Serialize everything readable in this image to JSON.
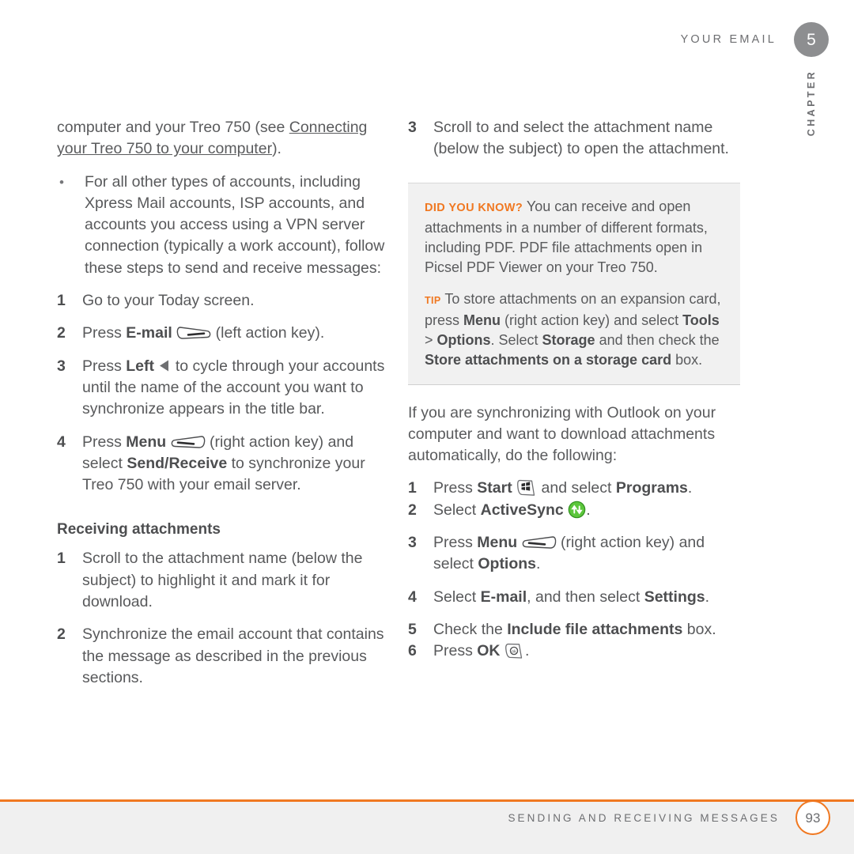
{
  "header": {
    "title": "YOUR EMAIL",
    "chapter_number": "5",
    "chapter_label": "CHAPTER"
  },
  "footer": {
    "title": "SENDING AND RECEIVING MESSAGES",
    "page_number": "93",
    "rule_color": "#f07821"
  },
  "colors": {
    "accent_orange": "#f07821",
    "body_text": "#5a5b5d",
    "bold_text": "#4d4e50",
    "tipbox_background": "#f1f1f1",
    "chapter_circle": "#8d8e90",
    "activesync_green": "#5cc63c"
  },
  "left_column": {
    "continued_paragraph": {
      "text_before": "computer and your Treo 750 (see ",
      "link_text": "Connecting your Treo 750 to your computer",
      "text_after": ")."
    },
    "bullet": {
      "marker": "•",
      "text": "For all other types of accounts, including Xpress Mail accounts, ISP accounts, and accounts you access using a VPN server connection (typically a work account), follow these steps to send and receive messages:"
    },
    "steps": [
      {
        "marker": "1",
        "segments": [
          {
            "text": "Go to your Today screen.",
            "style": "normal"
          }
        ]
      },
      {
        "marker": "2",
        "segments": [
          {
            "text": "Press ",
            "style": "normal"
          },
          {
            "text": "E-mail",
            "style": "bold"
          },
          {
            "text": " ",
            "style": "normal"
          },
          {
            "icon": "left-action-key-icon"
          },
          {
            "text": " (left action key).",
            "style": "normal"
          }
        ]
      },
      {
        "marker": "3",
        "segments": [
          {
            "text": "Press ",
            "style": "normal"
          },
          {
            "text": "Left",
            "style": "bold"
          },
          {
            "text": " ",
            "style": "normal"
          },
          {
            "icon": "left-arrow-icon"
          },
          {
            "text": " to cycle through your accounts until the name of the account you want to synchronize appears in the title bar.",
            "style": "normal"
          }
        ]
      },
      {
        "marker": "4",
        "segments": [
          {
            "text": "Press ",
            "style": "normal"
          },
          {
            "text": "Menu",
            "style": "bold"
          },
          {
            "text": " ",
            "style": "normal"
          },
          {
            "icon": "right-action-key-icon"
          },
          {
            "text": " (right action key) and select ",
            "style": "normal"
          },
          {
            "text": "Send/Receive",
            "style": "bold"
          },
          {
            "text": " to synchronize your Treo 750 with your email server.",
            "style": "normal"
          }
        ]
      }
    ],
    "subheading": "Receiving attachments",
    "attachment_steps": [
      {
        "marker": "1",
        "text": "Scroll to the attachment name (below the subject) to highlight it and mark it for download."
      },
      {
        "marker": "2",
        "text": "Synchronize the email account that contains the message as described in the previous sections."
      }
    ]
  },
  "right_column": {
    "step_three": {
      "marker": "3",
      "text": "Scroll to and select the attachment name (below the subject) to open the attachment."
    },
    "tipbox": {
      "did_you_know_label": "DID YOU KNOW?",
      "did_you_know_text": "You can receive and open attachments in a number of different formats, including PDF. PDF file attachments open in Picsel PDF Viewer on your Treo 750.",
      "tip_label": "TIP",
      "tip_segments": [
        {
          "text": "To store attachments on an expansion card, press ",
          "style": "normal"
        },
        {
          "text": "Menu",
          "style": "bold"
        },
        {
          "text": " (right action key) and select ",
          "style": "normal"
        },
        {
          "text": "Tools",
          "style": "bold"
        },
        {
          "text": " > ",
          "style": "normal"
        },
        {
          "text": "Options",
          "style": "bold"
        },
        {
          "text": ". Select ",
          "style": "normal"
        },
        {
          "text": "Storage",
          "style": "bold"
        },
        {
          "text": " and then check the ",
          "style": "normal"
        },
        {
          "text": "Store attachments on a storage card",
          "style": "bold"
        },
        {
          "text": " box.",
          "style": "normal"
        }
      ]
    },
    "intro_paragraph": "If you are synchronizing with Outlook on your computer and want to download attachments automatically, do the following:",
    "steps": [
      {
        "marker": "1",
        "segments": [
          {
            "text": "Press ",
            "style": "normal"
          },
          {
            "text": "Start",
            "style": "bold"
          },
          {
            "text": " ",
            "style": "normal"
          },
          {
            "icon": "start-windows-icon"
          },
          {
            "text": " and select ",
            "style": "normal"
          },
          {
            "text": "Programs",
            "style": "bold"
          },
          {
            "text": ".",
            "style": "normal"
          }
        ]
      },
      {
        "marker": "2",
        "segments": [
          {
            "text": "Select ",
            "style": "normal"
          },
          {
            "text": "ActiveSync",
            "style": "bold"
          },
          {
            "text": " ",
            "style": "normal"
          },
          {
            "icon": "activesync-icon"
          },
          {
            "text": ".",
            "style": "normal"
          }
        ]
      },
      {
        "marker": "3",
        "segments": [
          {
            "text": "Press ",
            "style": "normal"
          },
          {
            "text": "Menu",
            "style": "bold"
          },
          {
            "text": " ",
            "style": "normal"
          },
          {
            "icon": "right-action-key-icon"
          },
          {
            "text": " (right action key) and select ",
            "style": "normal"
          },
          {
            "text": "Options",
            "style": "bold"
          },
          {
            "text": ".",
            "style": "normal"
          }
        ]
      },
      {
        "marker": "4",
        "segments": [
          {
            "text": "Select ",
            "style": "normal"
          },
          {
            "text": "E-mail",
            "style": "bold"
          },
          {
            "text": ", and then select ",
            "style": "normal"
          },
          {
            "text": "Settings",
            "style": "bold"
          },
          {
            "text": ".",
            "style": "normal"
          }
        ]
      },
      {
        "marker": "5",
        "segments": [
          {
            "text": "Check the ",
            "style": "normal"
          },
          {
            "text": "Include file attachments",
            "style": "bold"
          },
          {
            "text": " box.",
            "style": "normal"
          }
        ]
      },
      {
        "marker": "6",
        "segments": [
          {
            "text": "Press ",
            "style": "normal"
          },
          {
            "text": "OK",
            "style": "bold"
          },
          {
            "text": " ",
            "style": "normal"
          },
          {
            "icon": "ok-key-icon"
          },
          {
            "text": ".",
            "style": "normal"
          }
        ]
      }
    ]
  }
}
